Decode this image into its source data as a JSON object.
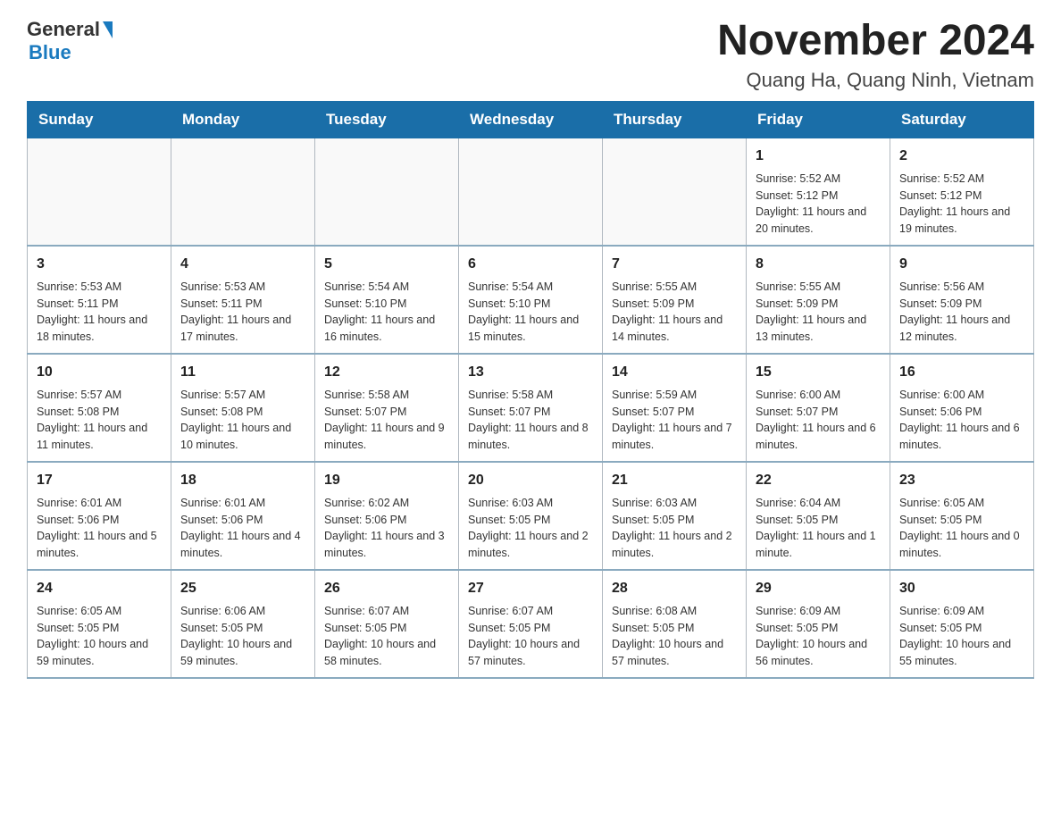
{
  "logo": {
    "general": "General",
    "blue": "Blue"
  },
  "title": "November 2024",
  "subtitle": "Quang Ha, Quang Ninh, Vietnam",
  "weekdays": [
    "Sunday",
    "Monday",
    "Tuesday",
    "Wednesday",
    "Thursday",
    "Friday",
    "Saturday"
  ],
  "weeks": [
    [
      {
        "day": "",
        "sunrise": "",
        "sunset": "",
        "daylight": ""
      },
      {
        "day": "",
        "sunrise": "",
        "sunset": "",
        "daylight": ""
      },
      {
        "day": "",
        "sunrise": "",
        "sunset": "",
        "daylight": ""
      },
      {
        "day": "",
        "sunrise": "",
        "sunset": "",
        "daylight": ""
      },
      {
        "day": "",
        "sunrise": "",
        "sunset": "",
        "daylight": ""
      },
      {
        "day": "1",
        "sunrise": "Sunrise: 5:52 AM",
        "sunset": "Sunset: 5:12 PM",
        "daylight": "Daylight: 11 hours and 20 minutes."
      },
      {
        "day": "2",
        "sunrise": "Sunrise: 5:52 AM",
        "sunset": "Sunset: 5:12 PM",
        "daylight": "Daylight: 11 hours and 19 minutes."
      }
    ],
    [
      {
        "day": "3",
        "sunrise": "Sunrise: 5:53 AM",
        "sunset": "Sunset: 5:11 PM",
        "daylight": "Daylight: 11 hours and 18 minutes."
      },
      {
        "day": "4",
        "sunrise": "Sunrise: 5:53 AM",
        "sunset": "Sunset: 5:11 PM",
        "daylight": "Daylight: 11 hours and 17 minutes."
      },
      {
        "day": "5",
        "sunrise": "Sunrise: 5:54 AM",
        "sunset": "Sunset: 5:10 PM",
        "daylight": "Daylight: 11 hours and 16 minutes."
      },
      {
        "day": "6",
        "sunrise": "Sunrise: 5:54 AM",
        "sunset": "Sunset: 5:10 PM",
        "daylight": "Daylight: 11 hours and 15 minutes."
      },
      {
        "day": "7",
        "sunrise": "Sunrise: 5:55 AM",
        "sunset": "Sunset: 5:09 PM",
        "daylight": "Daylight: 11 hours and 14 minutes."
      },
      {
        "day": "8",
        "sunrise": "Sunrise: 5:55 AM",
        "sunset": "Sunset: 5:09 PM",
        "daylight": "Daylight: 11 hours and 13 minutes."
      },
      {
        "day": "9",
        "sunrise": "Sunrise: 5:56 AM",
        "sunset": "Sunset: 5:09 PM",
        "daylight": "Daylight: 11 hours and 12 minutes."
      }
    ],
    [
      {
        "day": "10",
        "sunrise": "Sunrise: 5:57 AM",
        "sunset": "Sunset: 5:08 PM",
        "daylight": "Daylight: 11 hours and 11 minutes."
      },
      {
        "day": "11",
        "sunrise": "Sunrise: 5:57 AM",
        "sunset": "Sunset: 5:08 PM",
        "daylight": "Daylight: 11 hours and 10 minutes."
      },
      {
        "day": "12",
        "sunrise": "Sunrise: 5:58 AM",
        "sunset": "Sunset: 5:07 PM",
        "daylight": "Daylight: 11 hours and 9 minutes."
      },
      {
        "day": "13",
        "sunrise": "Sunrise: 5:58 AM",
        "sunset": "Sunset: 5:07 PM",
        "daylight": "Daylight: 11 hours and 8 minutes."
      },
      {
        "day": "14",
        "sunrise": "Sunrise: 5:59 AM",
        "sunset": "Sunset: 5:07 PM",
        "daylight": "Daylight: 11 hours and 7 minutes."
      },
      {
        "day": "15",
        "sunrise": "Sunrise: 6:00 AM",
        "sunset": "Sunset: 5:07 PM",
        "daylight": "Daylight: 11 hours and 6 minutes."
      },
      {
        "day": "16",
        "sunrise": "Sunrise: 6:00 AM",
        "sunset": "Sunset: 5:06 PM",
        "daylight": "Daylight: 11 hours and 6 minutes."
      }
    ],
    [
      {
        "day": "17",
        "sunrise": "Sunrise: 6:01 AM",
        "sunset": "Sunset: 5:06 PM",
        "daylight": "Daylight: 11 hours and 5 minutes."
      },
      {
        "day": "18",
        "sunrise": "Sunrise: 6:01 AM",
        "sunset": "Sunset: 5:06 PM",
        "daylight": "Daylight: 11 hours and 4 minutes."
      },
      {
        "day": "19",
        "sunrise": "Sunrise: 6:02 AM",
        "sunset": "Sunset: 5:06 PM",
        "daylight": "Daylight: 11 hours and 3 minutes."
      },
      {
        "day": "20",
        "sunrise": "Sunrise: 6:03 AM",
        "sunset": "Sunset: 5:05 PM",
        "daylight": "Daylight: 11 hours and 2 minutes."
      },
      {
        "day": "21",
        "sunrise": "Sunrise: 6:03 AM",
        "sunset": "Sunset: 5:05 PM",
        "daylight": "Daylight: 11 hours and 2 minutes."
      },
      {
        "day": "22",
        "sunrise": "Sunrise: 6:04 AM",
        "sunset": "Sunset: 5:05 PM",
        "daylight": "Daylight: 11 hours and 1 minute."
      },
      {
        "day": "23",
        "sunrise": "Sunrise: 6:05 AM",
        "sunset": "Sunset: 5:05 PM",
        "daylight": "Daylight: 11 hours and 0 minutes."
      }
    ],
    [
      {
        "day": "24",
        "sunrise": "Sunrise: 6:05 AM",
        "sunset": "Sunset: 5:05 PM",
        "daylight": "Daylight: 10 hours and 59 minutes."
      },
      {
        "day": "25",
        "sunrise": "Sunrise: 6:06 AM",
        "sunset": "Sunset: 5:05 PM",
        "daylight": "Daylight: 10 hours and 59 minutes."
      },
      {
        "day": "26",
        "sunrise": "Sunrise: 6:07 AM",
        "sunset": "Sunset: 5:05 PM",
        "daylight": "Daylight: 10 hours and 58 minutes."
      },
      {
        "day": "27",
        "sunrise": "Sunrise: 6:07 AM",
        "sunset": "Sunset: 5:05 PM",
        "daylight": "Daylight: 10 hours and 57 minutes."
      },
      {
        "day": "28",
        "sunrise": "Sunrise: 6:08 AM",
        "sunset": "Sunset: 5:05 PM",
        "daylight": "Daylight: 10 hours and 57 minutes."
      },
      {
        "day": "29",
        "sunrise": "Sunrise: 6:09 AM",
        "sunset": "Sunset: 5:05 PM",
        "daylight": "Daylight: 10 hours and 56 minutes."
      },
      {
        "day": "30",
        "sunrise": "Sunrise: 6:09 AM",
        "sunset": "Sunset: 5:05 PM",
        "daylight": "Daylight: 10 hours and 55 minutes."
      }
    ]
  ]
}
